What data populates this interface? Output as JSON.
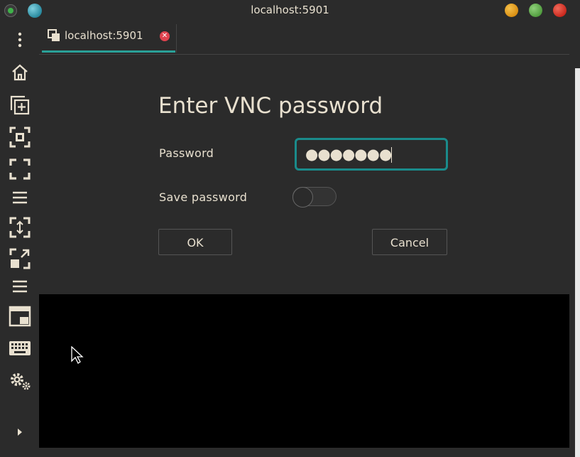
{
  "window": {
    "title": "localhost:5901"
  },
  "sidebar": {
    "items": [
      {
        "name": "menu",
        "icon": "kebab-menu-icon"
      },
      {
        "name": "home",
        "icon": "home-icon"
      },
      {
        "name": "new-tab",
        "icon": "new-tab-icon"
      },
      {
        "name": "fit-window",
        "icon": "fit-window-icon"
      },
      {
        "name": "fullscreen",
        "icon": "fullscreen-icon"
      },
      {
        "name": "menu-list",
        "icon": "list-icon"
      },
      {
        "name": "scale",
        "icon": "scale-icon"
      },
      {
        "name": "expand",
        "icon": "expand-icon"
      },
      {
        "name": "menu-list-2",
        "icon": "list-icon"
      },
      {
        "name": "pip",
        "icon": "picture-in-picture-icon"
      },
      {
        "name": "keyboard",
        "icon": "keyboard-icon"
      },
      {
        "name": "settings",
        "icon": "gear-icon"
      },
      {
        "name": "expand-sidebar",
        "icon": "triangle-right-icon"
      }
    ]
  },
  "tabs": [
    {
      "label": "localhost:5901",
      "active": true
    }
  ],
  "dialog": {
    "title": "Enter VNC password",
    "password_label": "Password",
    "password_value": "●●●●●●●",
    "save_label": "Save password",
    "save_enabled": false,
    "ok_label": "OK",
    "cancel_label": "Cancel"
  },
  "colors": {
    "accent": "#2aa198",
    "focus_border": "#1a8b8b",
    "close_tab": "#e0434f"
  }
}
